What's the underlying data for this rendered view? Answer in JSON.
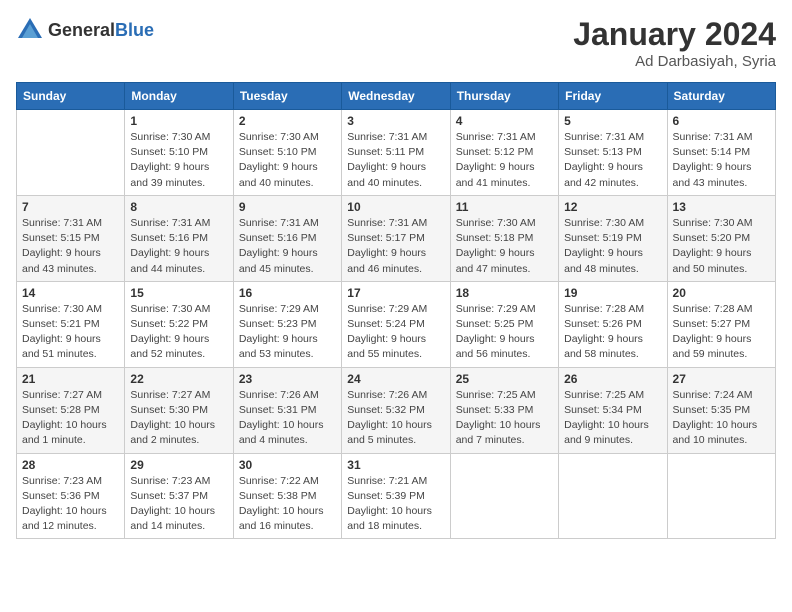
{
  "header": {
    "logo_general": "General",
    "logo_blue": "Blue",
    "month": "January 2024",
    "location": "Ad Darbasiyah, Syria"
  },
  "days_of_week": [
    "Sunday",
    "Monday",
    "Tuesday",
    "Wednesday",
    "Thursday",
    "Friday",
    "Saturday"
  ],
  "weeks": [
    [
      {
        "day": "",
        "info": ""
      },
      {
        "day": "1",
        "info": "Sunrise: 7:30 AM\nSunset: 5:10 PM\nDaylight: 9 hours\nand 39 minutes."
      },
      {
        "day": "2",
        "info": "Sunrise: 7:30 AM\nSunset: 5:10 PM\nDaylight: 9 hours\nand 40 minutes."
      },
      {
        "day": "3",
        "info": "Sunrise: 7:31 AM\nSunset: 5:11 PM\nDaylight: 9 hours\nand 40 minutes."
      },
      {
        "day": "4",
        "info": "Sunrise: 7:31 AM\nSunset: 5:12 PM\nDaylight: 9 hours\nand 41 minutes."
      },
      {
        "day": "5",
        "info": "Sunrise: 7:31 AM\nSunset: 5:13 PM\nDaylight: 9 hours\nand 42 minutes."
      },
      {
        "day": "6",
        "info": "Sunrise: 7:31 AM\nSunset: 5:14 PM\nDaylight: 9 hours\nand 43 minutes."
      }
    ],
    [
      {
        "day": "7",
        "info": "Sunrise: 7:31 AM\nSunset: 5:15 PM\nDaylight: 9 hours\nand 43 minutes."
      },
      {
        "day": "8",
        "info": "Sunrise: 7:31 AM\nSunset: 5:16 PM\nDaylight: 9 hours\nand 44 minutes."
      },
      {
        "day": "9",
        "info": "Sunrise: 7:31 AM\nSunset: 5:16 PM\nDaylight: 9 hours\nand 45 minutes."
      },
      {
        "day": "10",
        "info": "Sunrise: 7:31 AM\nSunset: 5:17 PM\nDaylight: 9 hours\nand 46 minutes."
      },
      {
        "day": "11",
        "info": "Sunrise: 7:30 AM\nSunset: 5:18 PM\nDaylight: 9 hours\nand 47 minutes."
      },
      {
        "day": "12",
        "info": "Sunrise: 7:30 AM\nSunset: 5:19 PM\nDaylight: 9 hours\nand 48 minutes."
      },
      {
        "day": "13",
        "info": "Sunrise: 7:30 AM\nSunset: 5:20 PM\nDaylight: 9 hours\nand 50 minutes."
      }
    ],
    [
      {
        "day": "14",
        "info": "Sunrise: 7:30 AM\nSunset: 5:21 PM\nDaylight: 9 hours\nand 51 minutes."
      },
      {
        "day": "15",
        "info": "Sunrise: 7:30 AM\nSunset: 5:22 PM\nDaylight: 9 hours\nand 52 minutes."
      },
      {
        "day": "16",
        "info": "Sunrise: 7:29 AM\nSunset: 5:23 PM\nDaylight: 9 hours\nand 53 minutes."
      },
      {
        "day": "17",
        "info": "Sunrise: 7:29 AM\nSunset: 5:24 PM\nDaylight: 9 hours\nand 55 minutes."
      },
      {
        "day": "18",
        "info": "Sunrise: 7:29 AM\nSunset: 5:25 PM\nDaylight: 9 hours\nand 56 minutes."
      },
      {
        "day": "19",
        "info": "Sunrise: 7:28 AM\nSunset: 5:26 PM\nDaylight: 9 hours\nand 58 minutes."
      },
      {
        "day": "20",
        "info": "Sunrise: 7:28 AM\nSunset: 5:27 PM\nDaylight: 9 hours\nand 59 minutes."
      }
    ],
    [
      {
        "day": "21",
        "info": "Sunrise: 7:27 AM\nSunset: 5:28 PM\nDaylight: 10 hours\nand 1 minute."
      },
      {
        "day": "22",
        "info": "Sunrise: 7:27 AM\nSunset: 5:30 PM\nDaylight: 10 hours\nand 2 minutes."
      },
      {
        "day": "23",
        "info": "Sunrise: 7:26 AM\nSunset: 5:31 PM\nDaylight: 10 hours\nand 4 minutes."
      },
      {
        "day": "24",
        "info": "Sunrise: 7:26 AM\nSunset: 5:32 PM\nDaylight: 10 hours\nand 5 minutes."
      },
      {
        "day": "25",
        "info": "Sunrise: 7:25 AM\nSunset: 5:33 PM\nDaylight: 10 hours\nand 7 minutes."
      },
      {
        "day": "26",
        "info": "Sunrise: 7:25 AM\nSunset: 5:34 PM\nDaylight: 10 hours\nand 9 minutes."
      },
      {
        "day": "27",
        "info": "Sunrise: 7:24 AM\nSunset: 5:35 PM\nDaylight: 10 hours\nand 10 minutes."
      }
    ],
    [
      {
        "day": "28",
        "info": "Sunrise: 7:23 AM\nSunset: 5:36 PM\nDaylight: 10 hours\nand 12 minutes."
      },
      {
        "day": "29",
        "info": "Sunrise: 7:23 AM\nSunset: 5:37 PM\nDaylight: 10 hours\nand 14 minutes."
      },
      {
        "day": "30",
        "info": "Sunrise: 7:22 AM\nSunset: 5:38 PM\nDaylight: 10 hours\nand 16 minutes."
      },
      {
        "day": "31",
        "info": "Sunrise: 7:21 AM\nSunset: 5:39 PM\nDaylight: 10 hours\nand 18 minutes."
      },
      {
        "day": "",
        "info": ""
      },
      {
        "day": "",
        "info": ""
      },
      {
        "day": "",
        "info": ""
      }
    ]
  ]
}
